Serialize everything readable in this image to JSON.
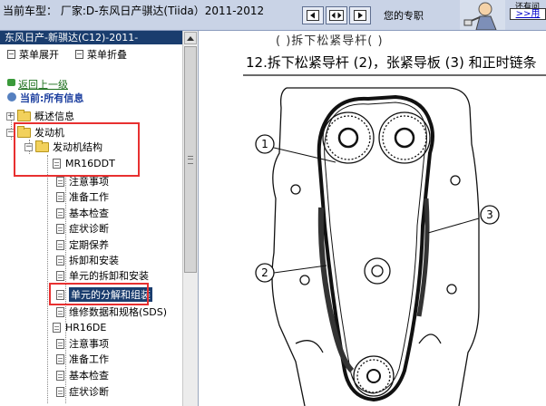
{
  "header": {
    "vehicle_label": "当前车型： 厂家:D-东风日产骐达(Tiida）2011-2012",
    "expert_label": "您的专职",
    "here_text": "还有问",
    "here_link": ">>用",
    "nav_buttons": [
      "prev-icon",
      "nav-center-icon",
      "next-icon"
    ]
  },
  "panel": {
    "title": "东风日产-新骐达(C12)-2011-",
    "expand_all": "菜单展开",
    "collapse_all": "菜单折叠",
    "back_link": "返回上一级",
    "current_label": "当前:所有信息",
    "tree": [
      {
        "label": "概述信息"
      },
      {
        "label": "发动机"
      },
      {
        "label": "发动机结构"
      },
      {
        "label": "MR16DDT"
      },
      {
        "label": "注意事项"
      },
      {
        "label": "准备工作"
      },
      {
        "label": "基本检查"
      },
      {
        "label": "症状诊断"
      },
      {
        "label": "定期保养"
      },
      {
        "label": "拆卸和安装"
      },
      {
        "label": "单元的拆卸和安装"
      },
      {
        "label": "单元的分解和组装"
      },
      {
        "label": "维修数据和规格(SDS)"
      },
      {
        "label": "HR16DE"
      },
      {
        "label": "注意事项"
      },
      {
        "label": "准备工作"
      },
      {
        "label": "基本检查"
      },
      {
        "label": "症状诊断"
      }
    ]
  },
  "content": {
    "prev_fragment": "(  )拆下松紧导杆(  )",
    "step_text": "12.拆下松紧导杆 (2)，张紧导板 (3) 和正时链条",
    "callouts": [
      "1",
      "2",
      "3"
    ]
  },
  "colors": {
    "header_bg": "#c9d3e6",
    "panel_title_bg": "#1a3d6e",
    "highlight_box": "#e83030",
    "link_green": "#1a6e1a",
    "current_blue": "#1a3d9e"
  }
}
